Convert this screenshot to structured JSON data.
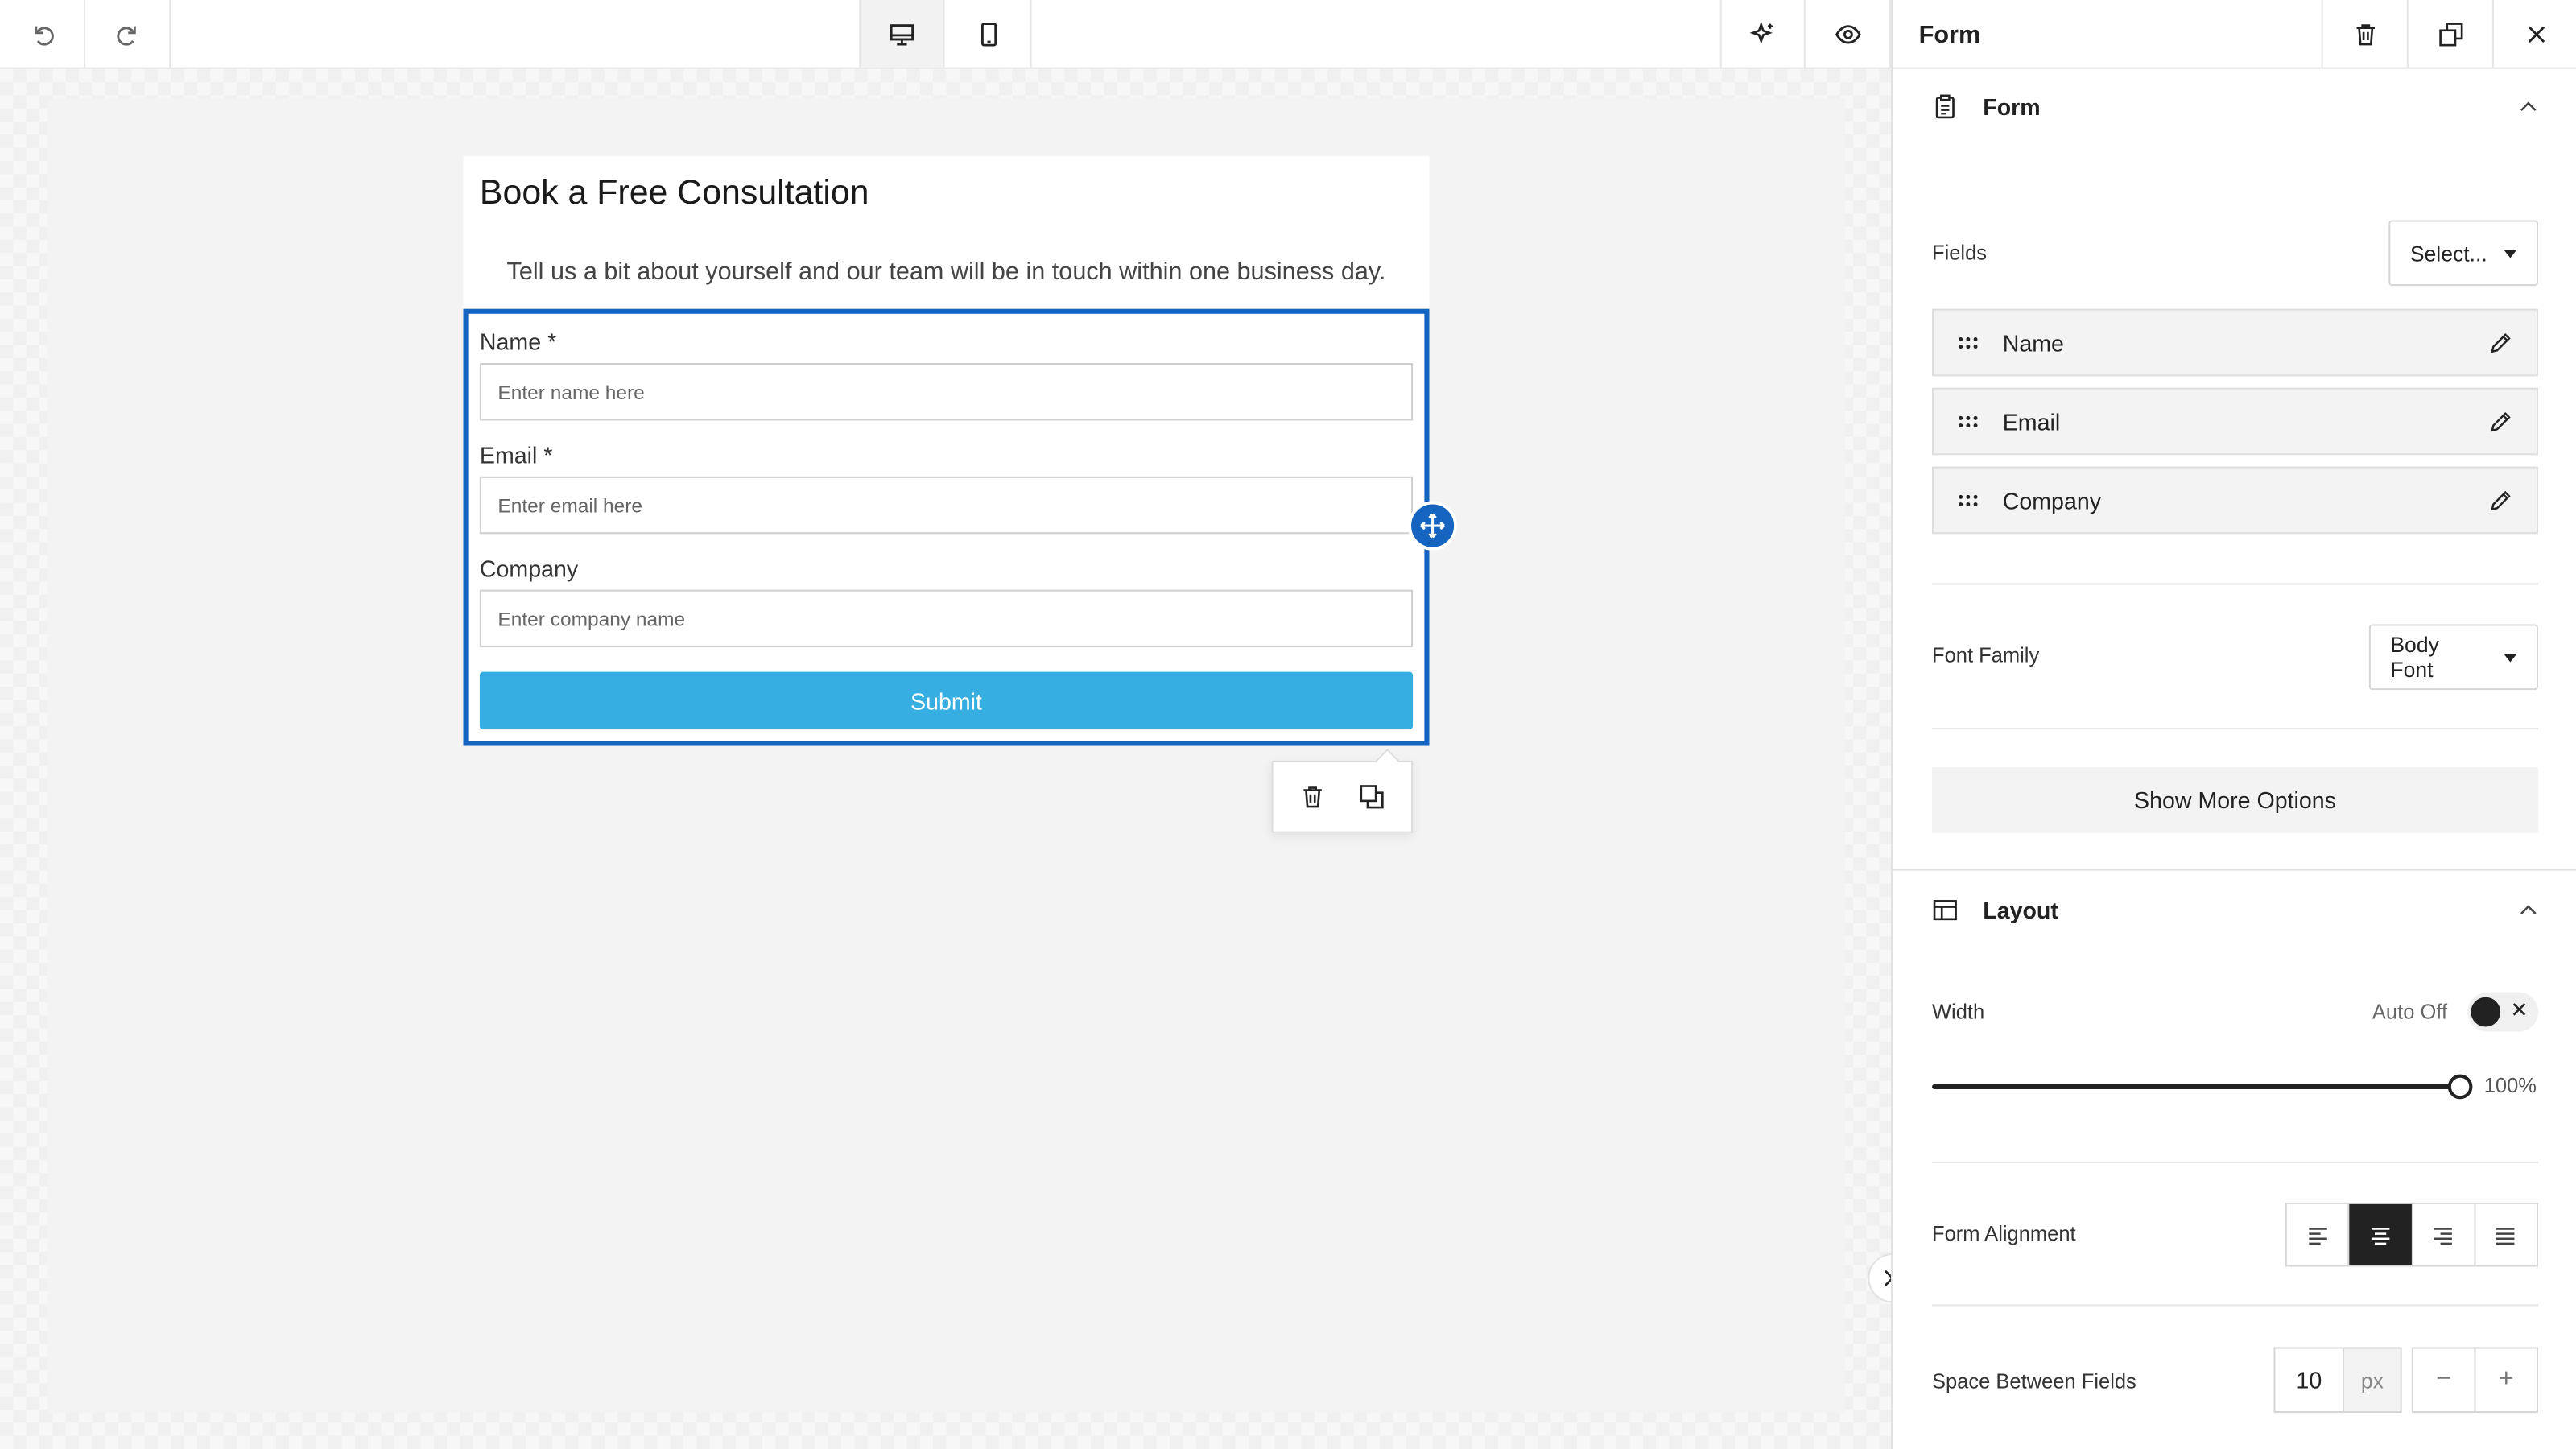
{
  "toolbar": {
    "undo_icon": "undo-icon",
    "redo_icon": "redo-icon",
    "desktop_icon": "desktop-icon",
    "mobile_icon": "mobile-icon",
    "ai_icon": "sparkle-icon",
    "preview_icon": "eye-icon"
  },
  "canvas": {
    "form_title": "Book a Free Consultation",
    "form_subtitle": "Tell us a bit about yourself and our team will be in touch within one business day.",
    "fields": [
      {
        "label": "Name *",
        "placeholder": "Enter name here"
      },
      {
        "label": "Email *",
        "placeholder": "Enter email here"
      },
      {
        "label": "Company",
        "placeholder": "Enter company name"
      }
    ],
    "submit_label": "Submit",
    "accent_color": "#1565c0",
    "submit_color": "#37aee2"
  },
  "panel": {
    "title": "Form",
    "form_section": {
      "title": "Form",
      "fields_label": "Fields",
      "fields_select": "Select...",
      "field_items": [
        "Name",
        "Email",
        "Company"
      ],
      "font_family_label": "Font Family",
      "font_family_value": "Body Font",
      "more_options": "Show More Options"
    },
    "layout_section": {
      "title": "Layout",
      "width_label": "Width",
      "auto_label": "Auto Off",
      "width_value": "100%",
      "width_fraction": 1.0,
      "alignment_label": "Form Alignment",
      "alignment_selected": "center",
      "spacing_label": "Space Between Fields",
      "spacing_value": "10",
      "spacing_unit": "px",
      "minus": "−",
      "plus": "+"
    }
  }
}
